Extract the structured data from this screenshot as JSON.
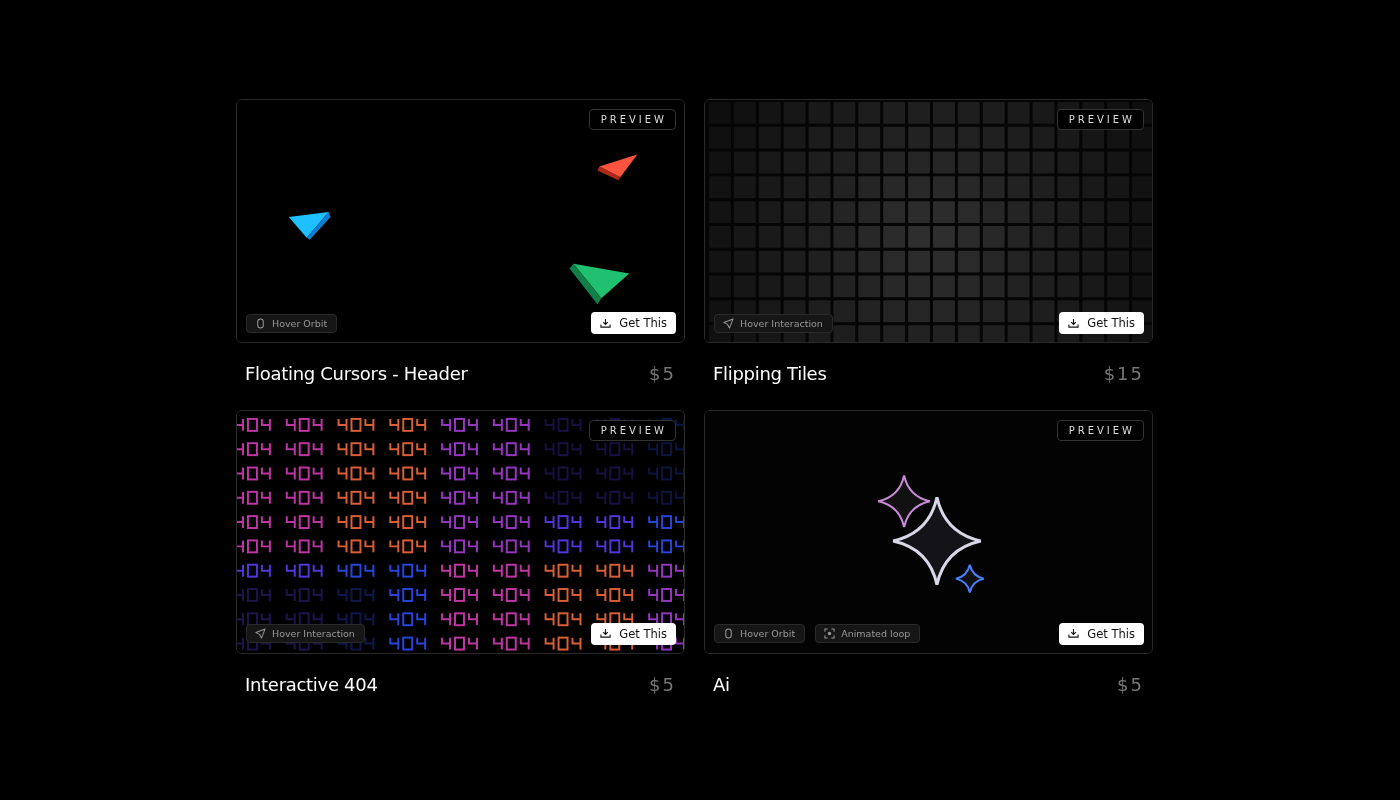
{
  "cards": [
    {
      "preview": {
        "kind": "picture"
      },
      "badge": "PREVIEW",
      "chips": [
        {
          "kind": "mouse",
          "label": "Hover Orbit"
        }
      ],
      "button": "Get This",
      "title": "Floating Cursors - Header",
      "price": "$5"
    },
    {
      "preview": {
        "kind": "picture"
      },
      "badge": "PREVIEW",
      "chips": [
        {
          "kind": "pointer",
          "label": "Hover Interaction"
        }
      ],
      "button": "Get This",
      "title": "Flipping Tiles",
      "price": "$15"
    },
    {
      "preview": {
        "kind": "picture"
      },
      "badge": "PREVIEW",
      "chips": [
        {
          "kind": "pointer",
          "label": "Hover Interaction"
        }
      ],
      "button": "Get This",
      "title": "Interactive 404",
      "price": "$5"
    },
    {
      "preview": {
        "kind": "picture"
      },
      "badge": "PREVIEW",
      "chips": [
        {
          "kind": "mouse",
          "label": "Hover Orbit"
        },
        {
          "kind": "focus",
          "label": "Animated loop"
        }
      ],
      "button": "Get This",
      "title": "Ai",
      "price": "$5"
    }
  ]
}
